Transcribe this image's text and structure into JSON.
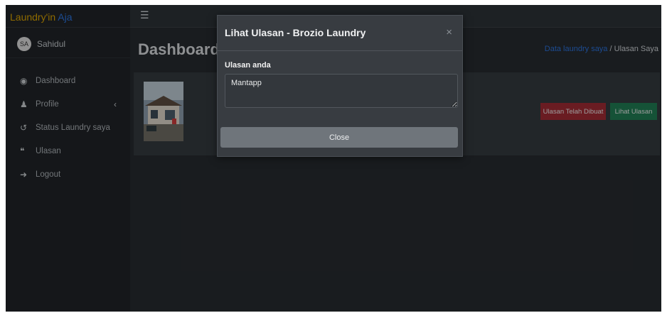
{
  "brand": {
    "part1": "Laundry'in",
    "part2": "Aja"
  },
  "user": {
    "initials": "SA",
    "name": "Sahidul"
  },
  "sidebar": {
    "items": [
      {
        "label": "Dashboard",
        "icon": "tachometer-icon"
      },
      {
        "label": "Profile",
        "icon": "user-icon"
      },
      {
        "label": "Status Laundry saya",
        "icon": "history-icon"
      },
      {
        "label": "Ulasan",
        "icon": "quote-icon"
      },
      {
        "label": "Logout",
        "icon": "sign-out-icon"
      }
    ]
  },
  "topbar": {
    "menu_icon": "hamburger-icon"
  },
  "page": {
    "title": "Dashboard C"
  },
  "breadcrumb": {
    "link": "Data laundry saya",
    "separator": "/",
    "current": "Ulasan Saya"
  },
  "card": {
    "btn_review_made": "Ulasan Telah Dibuat",
    "btn_view_review": "Lihat Ulasan"
  },
  "modal": {
    "title": "Lihat Ulasan - Brozio Laundry",
    "close_symbol": "×",
    "field_label": "Ulasan anda",
    "review_value": "Mantapp",
    "close_label": "Close"
  },
  "colors": {
    "brand_yellow": "#d39e00",
    "brand_blue": "#2a6fd6",
    "danger": "#9c2a33",
    "success": "#1f7a52"
  }
}
